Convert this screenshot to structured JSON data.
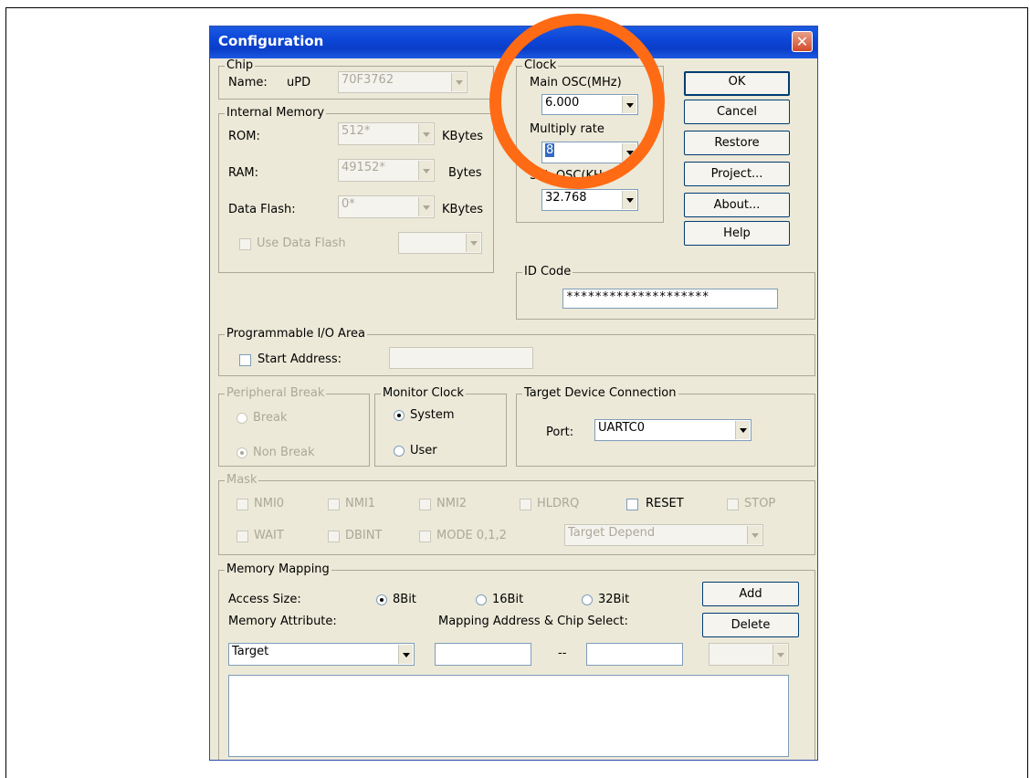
{
  "dialog": {
    "title": "Configuration"
  },
  "chip": {
    "group_label": "Chip",
    "name_label": "Name:",
    "prefix": "uPD",
    "name_value": "70F3762"
  },
  "internal_memory": {
    "group_label": "Internal Memory",
    "rom": {
      "label": "ROM:",
      "value": "512*",
      "unit": "KBytes"
    },
    "ram": {
      "label": "RAM:",
      "value": "49152*",
      "unit": "Bytes"
    },
    "data_flash": {
      "label": "Data Flash:",
      "value": "0*",
      "unit": "KBytes"
    },
    "use_data_flash_label": "Use Data Flash"
  },
  "clock": {
    "group_label": "Clock",
    "main_osc_label": "Main OSC(MHz)",
    "main_osc_value": "6.000",
    "multiply_label": "Multiply rate",
    "multiply_value": "8",
    "sub_osc_label": "Sub OSC(KHz)",
    "sub_osc_value": "32.768"
  },
  "buttons": {
    "ok": "OK",
    "cancel": "Cancel",
    "restore": "Restore",
    "project": "Project...",
    "about": "About...",
    "help": "Help"
  },
  "id_code": {
    "group_label": "ID Code",
    "value": "********************"
  },
  "programmable_io": {
    "group_label": "Programmable I/O Area",
    "start_address_label": "Start Address:"
  },
  "peripheral_break": {
    "group_label": "Peripheral Break",
    "break_label": "Break",
    "non_break_label": "Non Break"
  },
  "monitor_clock": {
    "group_label": "Monitor Clock",
    "system_label": "System",
    "user_label": "User"
  },
  "target_connection": {
    "group_label": "Target Device Connection",
    "port_label": "Port:",
    "port_value": "UARTC0"
  },
  "mask": {
    "group_label": "Mask",
    "items": [
      "NMI0",
      "NMI1",
      "NMI2",
      "HLDRQ",
      "RESET",
      "STOP",
      "WAIT",
      "DBINT",
      "MODE 0,1,2"
    ],
    "target_depend": "Target Depend"
  },
  "memory_mapping": {
    "group_label": "Memory Mapping",
    "access_size_label": "Access Size:",
    "size_8": "8Bit",
    "size_16": "16Bit",
    "size_32": "32Bit",
    "attribute_label": "Memory Attribute:",
    "mapping_label": "Mapping Address & Chip Select:",
    "attribute_value": "Target",
    "separator": "--",
    "add_label": "Add",
    "delete_label": "Delete"
  },
  "annotation": {
    "color": "#ff6a14"
  }
}
